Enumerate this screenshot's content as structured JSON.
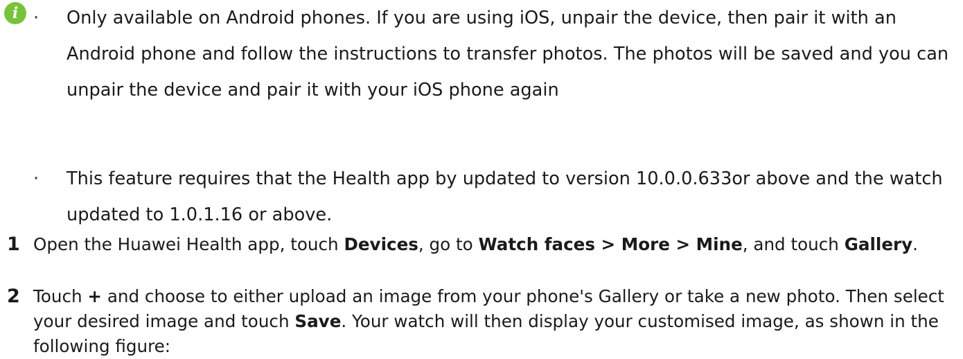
{
  "note": {
    "icon": "info-icon",
    "icon_color": "#77c33b",
    "bullets": [
      {
        "text": "Only available on Android phones. If you are using iOS, unpair the device, then pair it with an Android phone and follow the instructions to transfer photos. The photos will be saved and you can unpair the device and pair it with your iOS phone again"
      },
      {
        "text": "This feature requires that the Health app by updated to version 10.0.0.633or above and the watch updated to 1.0.1.16 or above."
      }
    ]
  },
  "steps": [
    {
      "number": "1",
      "parts": [
        {
          "t": "Open the Huawei Health app, touch ",
          "bold": false
        },
        {
          "t": "Devices",
          "bold": true
        },
        {
          "t": ", go to ",
          "bold": false
        },
        {
          "t": "Watch faces",
          "bold": true
        },
        {
          "t": " > ",
          "bold": true
        },
        {
          "t": "More",
          "bold": true
        },
        {
          "t": " > ",
          "bold": true
        },
        {
          "t": "Mine",
          "bold": true
        },
        {
          "t": ", and touch ",
          "bold": false
        },
        {
          "t": "Gallery",
          "bold": true
        },
        {
          "t": ".",
          "bold": false
        }
      ]
    },
    {
      "number": "2",
      "parts": [
        {
          "t": "Touch ",
          "bold": false
        },
        {
          "t": "+",
          "bold": true
        },
        {
          "t": " and choose to either upload an image from your phone's Gallery or take a new photo. Then select your desired image and touch ",
          "bold": false
        },
        {
          "t": "Save",
          "bold": true
        },
        {
          "t": ". Your watch will then display your customised image, as shown in the following figure:",
          "bold": false
        }
      ]
    }
  ]
}
